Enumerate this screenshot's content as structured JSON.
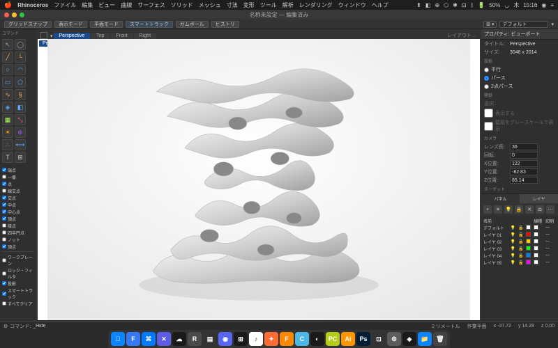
{
  "mac": {
    "app_name": "Rhinoceros",
    "menus": [
      "ファイル",
      "編集",
      "ビュー",
      "曲線",
      "サーフェス",
      "ソリッド",
      "メッシュ",
      "寸法",
      "変形",
      "ツール",
      "解析",
      "レンダリング",
      "ウィンドウ",
      "ヘルプ"
    ],
    "battery": "50%",
    "day": "木",
    "time": "15:16"
  },
  "title": "名称未設定 — 編集済み",
  "toolbar": {
    "grid_snap": "グリッドスナップ",
    "display_mode": "表示モード",
    "plane_mode": "平面モード",
    "smart_track": "スマートトラック",
    "gumball": "ガムボール",
    "history": "ヒストリ",
    "default_label": "デフォルト"
  },
  "viewport": {
    "tabs": [
      "Perspective",
      "Top",
      "Front",
      "Right"
    ],
    "active_label": "Perspective",
    "layout_label": "レイアウト..."
  },
  "osnap": {
    "items": [
      {
        "label": "端点",
        "checked": true
      },
      {
        "label": "一番",
        "checked": false
      },
      {
        "label": "点",
        "checked": true
      },
      {
        "label": "線交点",
        "checked": false
      },
      {
        "label": "交点",
        "checked": true
      },
      {
        "label": "中点",
        "checked": true
      },
      {
        "label": "中心点",
        "checked": true
      },
      {
        "label": "頂点",
        "checked": true
      },
      {
        "label": "接点",
        "checked": false
      },
      {
        "label": "四半円点",
        "checked": false
      },
      {
        "label": "ノット",
        "checked": false
      },
      {
        "label": "頂点",
        "checked": true
      }
    ],
    "sections": [
      {
        "label": "ワークプレーン",
        "checked": false
      },
      {
        "label": "ロック・フィルタ",
        "checked": false
      },
      {
        "label": "投影",
        "checked": true
      },
      {
        "label": "スマートトラック",
        "checked": true
      }
    ],
    "all_clear": "すべてクリア"
  },
  "props": {
    "header": "プロパティ: ビューポート",
    "title_lbl": "タイトル:",
    "title_val": "Perspective",
    "size_lbl": "サイズ:",
    "size_val": "3048 x 2014",
    "proj_hdr": "投影",
    "proj_parallel": "平行",
    "proj_perspective": "パース",
    "proj_2pt": "2点パース",
    "wall_hdr": "壁紙",
    "wall_sel": "選択...",
    "wall_show": "表示する",
    "wall_gray": "壁紙をグレースケールで表示",
    "cam_hdr": "カメラ",
    "lens_lbl": "レンズ長:",
    "lens_val": "36",
    "rot_lbl": "回転:",
    "rot_val": "0",
    "x_lbl": "X位置:",
    "x_val": "122",
    "y_lbl": "Y位置:",
    "y_val": "-82.83",
    "z_lbl": "Z位置:",
    "z_val": "85.14",
    "target_hdr": "ターゲット"
  },
  "panel_tabs": {
    "panel": "パネル",
    "layer": "レイヤ"
  },
  "layers": {
    "header": "名前",
    "rows": [
      {
        "name": "デフォルト",
        "color": "#ffffff"
      },
      {
        "name": "レイヤ 01",
        "color": "#ff0000"
      },
      {
        "name": "レイヤ 02",
        "color": "#ffc800"
      },
      {
        "name": "レイヤ 03",
        "color": "#00ff00"
      },
      {
        "name": "レイヤ 04",
        "color": "#0080ff"
      },
      {
        "name": "レイヤ 05",
        "color": "#ff00ff"
      }
    ],
    "mat_col": "線種",
    "print_col": "印刷"
  },
  "status": {
    "cmd_lbl": "コマンド:",
    "cmd_val": "_Hide",
    "units": "ミリメートル",
    "cplane": "作業平面",
    "x": "x -37.72",
    "y": "y 14.28",
    "z": "z 0.00"
  },
  "dock_apps": [
    {
      "bg": "#0a84ff",
      "txt": "􀣺"
    },
    {
      "bg": "#3478f6",
      "txt": "F"
    },
    {
      "bg": "#007aff",
      "txt": "⌘"
    },
    {
      "bg": "#5e5ce6",
      "txt": "✕"
    },
    {
      "bg": "#1a1a1a",
      "txt": "☁"
    },
    {
      "bg": "#4a4a4a",
      "txt": "R"
    },
    {
      "bg": "#333333",
      "txt": "▤"
    },
    {
      "bg": "#5865f2",
      "txt": "◉"
    },
    {
      "bg": "#1a1a1a",
      "txt": "⊞"
    },
    {
      "bg": "#ffffff",
      "txt": "♪"
    },
    {
      "bg": "#ff6b35",
      "txt": "✦"
    },
    {
      "bg": "#ff8800",
      "txt": "F"
    },
    {
      "bg": "#4db8e8",
      "txt": "C"
    },
    {
      "bg": "#1a1a1a",
      "txt": "◐"
    },
    {
      "bg": "#b5cc18",
      "txt": "PC"
    },
    {
      "bg": "#ff9500",
      "txt": "Ai"
    },
    {
      "bg": "#001e36",
      "txt": "Ps"
    },
    {
      "bg": "#333333",
      "txt": "⊡"
    },
    {
      "bg": "#5c5c5c",
      "txt": "⚙"
    },
    {
      "bg": "#1a1a1a",
      "txt": "◈"
    },
    {
      "bg": "#0a84ff",
      "txt": "📁"
    },
    {
      "bg": "#444444",
      "txt": "🗑"
    }
  ]
}
